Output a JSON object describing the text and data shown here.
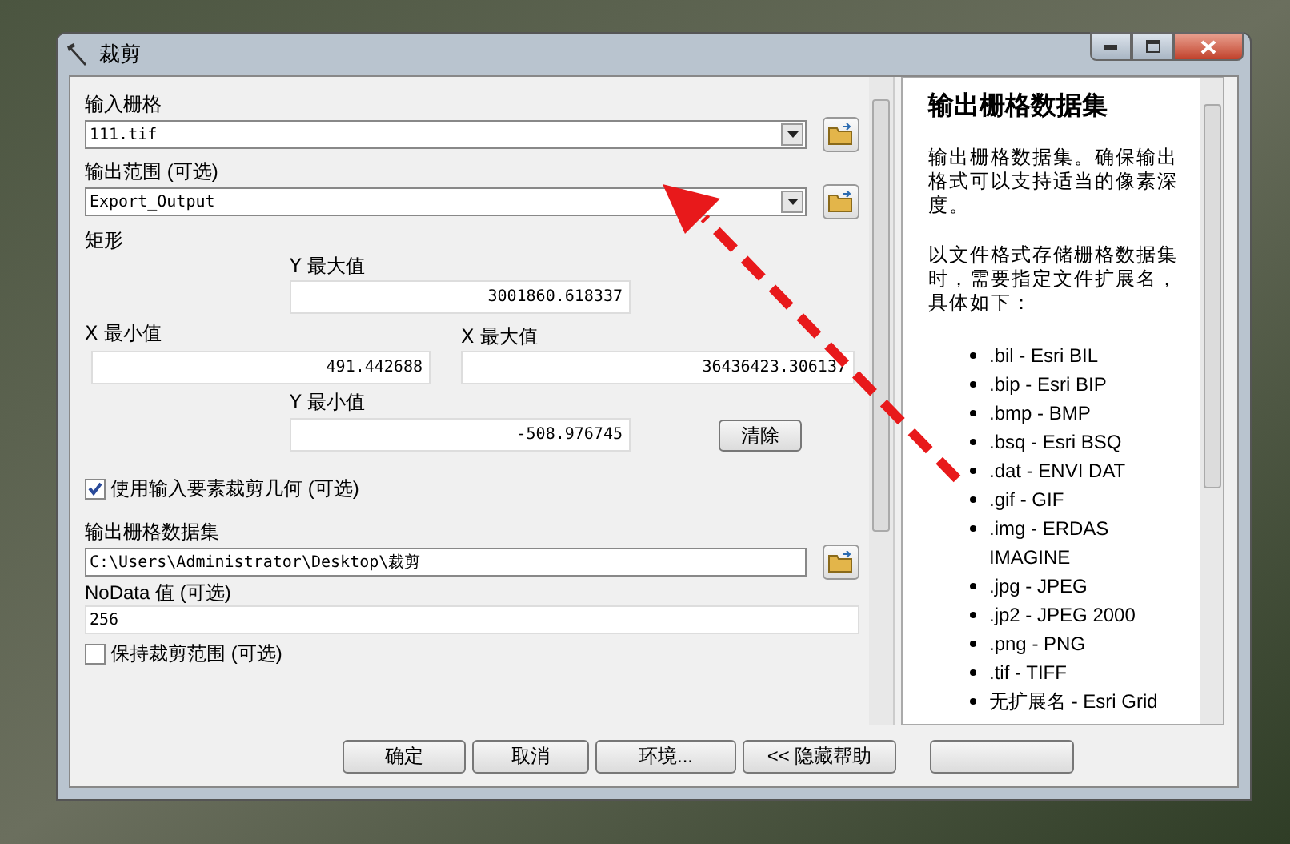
{
  "window": {
    "title": "裁剪"
  },
  "form": {
    "input_raster": {
      "label": "输入栅格",
      "value": "111.tif"
    },
    "output_extent": {
      "label": "输出范围 (可选)",
      "value": "Export_Output"
    },
    "rectangle": {
      "label": "矩形",
      "y_max": {
        "label": "Y 最大值",
        "value": "3001860.618337"
      },
      "x_min": {
        "label": "X 最小值",
        "value": "491.442688"
      },
      "x_max": {
        "label": "X 最大值",
        "value": "36436423.306137"
      },
      "y_min": {
        "label": "Y 最小值",
        "value": "-508.976745"
      },
      "clear_button": "清除"
    },
    "use_input_features": {
      "label": "使用输入要素裁剪几何 (可选)",
      "checked": true
    },
    "output_raster": {
      "label": "输出栅格数据集",
      "value": "C:\\Users\\Administrator\\Desktop\\裁剪"
    },
    "nodata": {
      "label": "NoData 值 (可选)",
      "value": "256"
    },
    "maintain_extent": {
      "label": "保持裁剪范围 (可选)",
      "checked": false
    }
  },
  "help": {
    "title": "输出栅格数据集",
    "paragraphs": [
      "输出栅格数据集。确保输出格式可以支持适当的像素深度。",
      "以文件格式存储栅格数据集时，需要指定文件扩展名，具体如下："
    ],
    "items": [
      ".bil - Esri BIL",
      ".bip - Esri BIP",
      ".bmp - BMP",
      ".bsq - Esri BSQ",
      ".dat - ENVI DAT",
      ".gif - GIF",
      ".img - ERDAS IMAGINE",
      ".jpg - JPEG",
      ".jp2 - JPEG 2000",
      ".png - PNG",
      ".tif - TIFF",
      "无扩展名 - Esri Grid"
    ]
  },
  "buttons": [
    "确定",
    "取消",
    "环境...",
    "<< 隐藏帮助"
  ]
}
